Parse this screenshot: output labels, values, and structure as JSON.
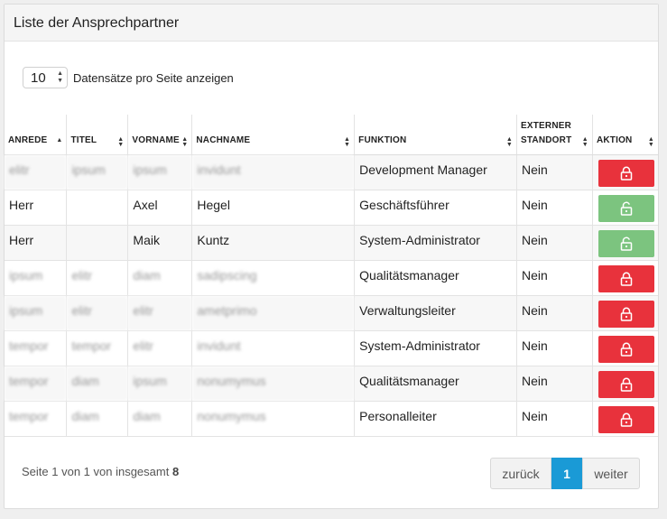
{
  "panel": {
    "title": "Liste der Ansprechpartner"
  },
  "length": {
    "value": "10",
    "label": "Datensätze pro Seite anzeigen"
  },
  "columns": [
    {
      "label": "ANREDE",
      "width": 69
    },
    {
      "label": "TITEL",
      "width": 68
    },
    {
      "label": "VORNAME",
      "width": 71
    },
    {
      "label": "NACHNAME",
      "width": 180
    },
    {
      "label": "FUNKTION",
      "width": 180
    },
    {
      "label": "EXTERNER STANDORT",
      "width": 84
    },
    {
      "label": "AKTION",
      "width": 72
    }
  ],
  "rows": [
    {
      "anrede": "elitr",
      "titel": "ipsum",
      "vorname": "ipsum",
      "nachname": "invidunt",
      "funktion": "Development Manager",
      "standort": "Nein",
      "status": "locked",
      "blurred": true
    },
    {
      "anrede": "Herr",
      "titel": "",
      "vorname": "Axel",
      "nachname": "Hegel",
      "funktion": "Geschäftsführer",
      "standort": "Nein",
      "status": "unlocked",
      "blurred": false
    },
    {
      "anrede": "Herr",
      "titel": "",
      "vorname": "Maik",
      "nachname": "Kuntz",
      "funktion": "System-Administrator",
      "standort": "Nein",
      "status": "unlocked",
      "blurred": false
    },
    {
      "anrede": "ipsum",
      "titel": "elitr",
      "vorname": "diam",
      "nachname": "sadipscing",
      "funktion": "Qualitätsmanager",
      "standort": "Nein",
      "status": "locked",
      "blurred": true
    },
    {
      "anrede": "ipsum",
      "titel": "elitr",
      "vorname": "elitr",
      "nachname": "ametprimo",
      "funktion": "Verwaltungsleiter",
      "standort": "Nein",
      "status": "locked",
      "blurred": true
    },
    {
      "anrede": "tempor",
      "titel": "tempor",
      "vorname": "elitr",
      "nachname": "invidunt",
      "funktion": "System-Administrator",
      "standort": "Nein",
      "status": "locked",
      "blurred": true
    },
    {
      "anrede": "tempor",
      "titel": "diam",
      "vorname": "ipsum",
      "nachname": "nonumymus",
      "funktion": "Qualitätsmanager",
      "standort": "Nein",
      "status": "locked",
      "blurred": true
    },
    {
      "anrede": "tempor",
      "titel": "diam",
      "vorname": "diam",
      "nachname": "nonumymus",
      "funktion": "Personalleiter",
      "standort": "Nein",
      "status": "locked",
      "blurred": true
    }
  ],
  "colors": {
    "locked": "#e8323c",
    "unlocked": "#7cc47f",
    "accent": "#1a9ad6"
  },
  "icons": {
    "action": "lock-icon"
  },
  "footer": {
    "info_prefix": "Seite 1 von 1 von insgesamt",
    "info_total": "8"
  },
  "pagination": {
    "prev": "zurück",
    "current": "1",
    "next": "weiter"
  }
}
